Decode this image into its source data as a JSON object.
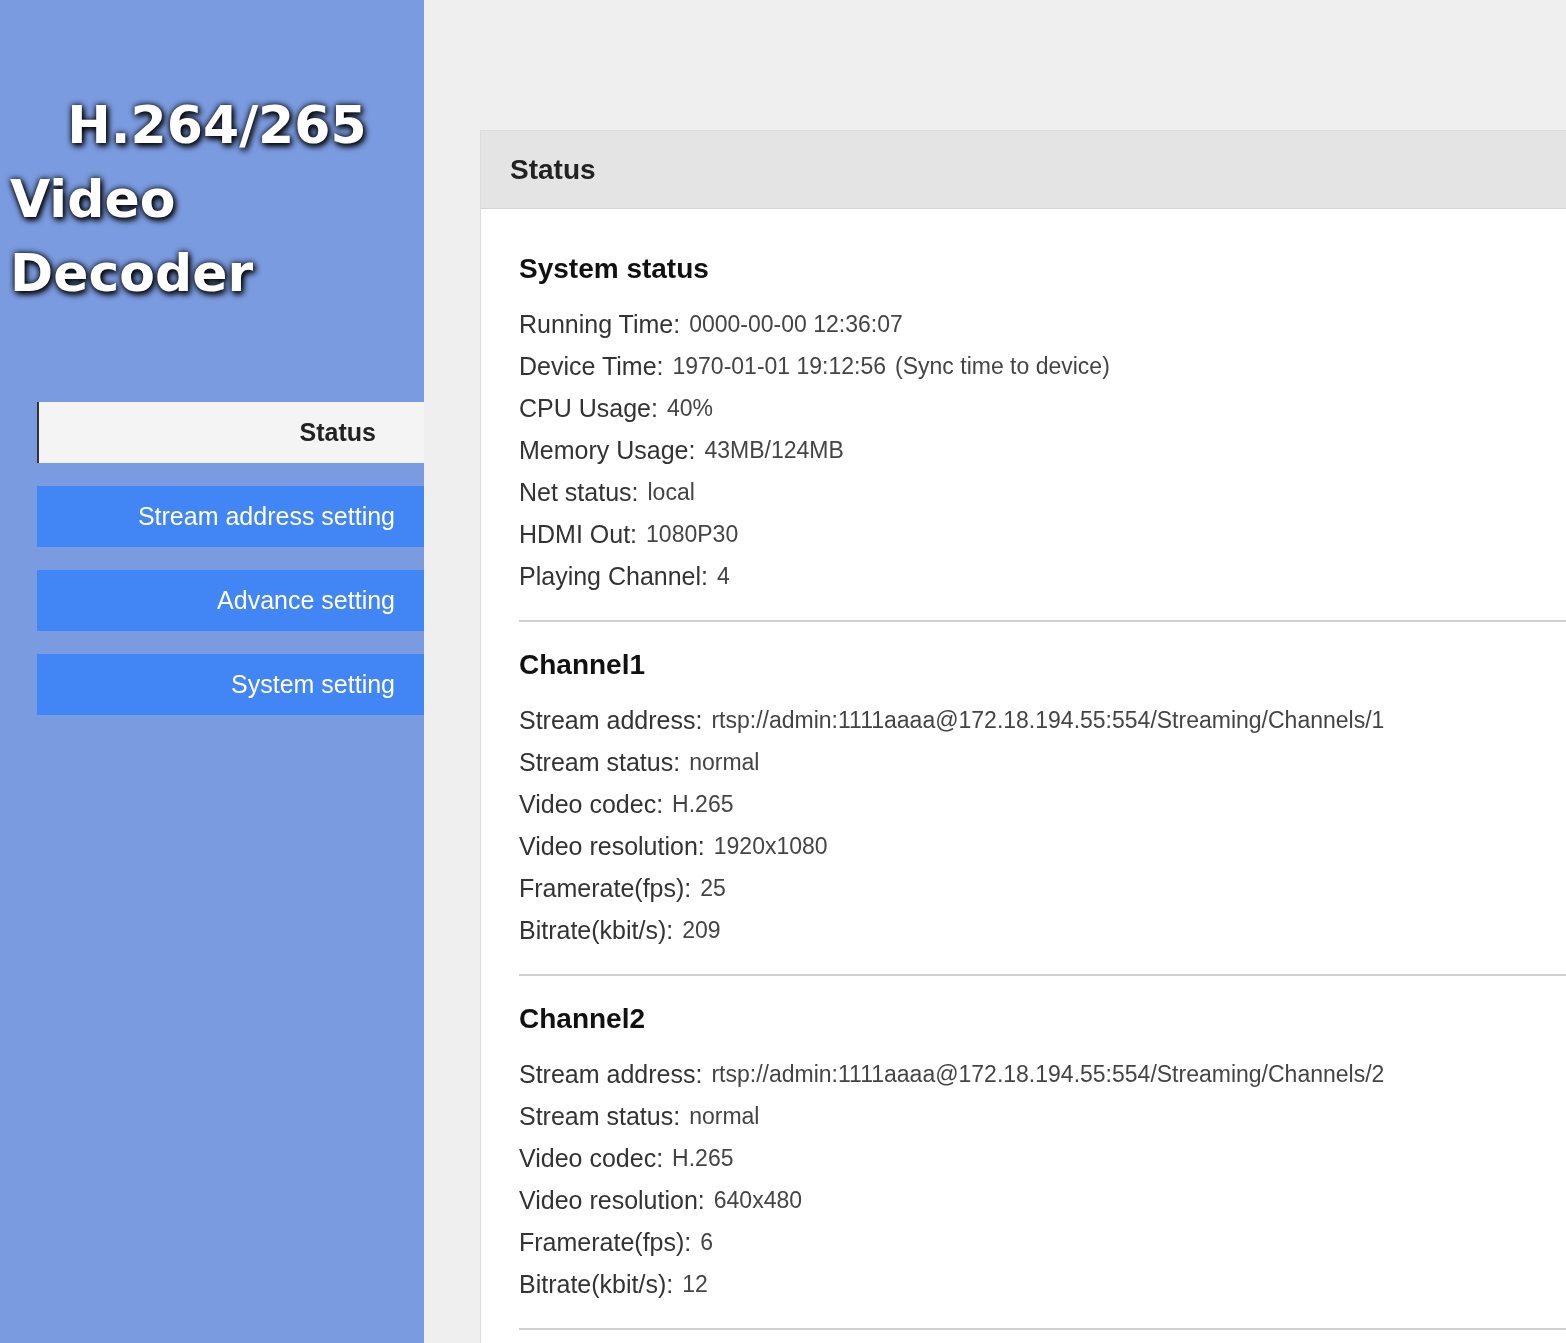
{
  "sidebar": {
    "logo": [
      "H.264/265",
      "Video Decoder"
    ],
    "items": [
      {
        "label": "Status",
        "selected": true
      },
      {
        "label": "Stream address setting",
        "selected": false
      },
      {
        "label": "Advance setting",
        "selected": false
      },
      {
        "label": "System setting",
        "selected": false
      }
    ]
  },
  "panel": {
    "title": "Status",
    "sections": [
      {
        "title": "System status",
        "rows": [
          {
            "label": "Running Time:",
            "value": "0000-00-00 12:36:07"
          },
          {
            "label": "Device Time:",
            "value": "1970-01-01 19:12:56",
            "link": "(Sync time to device)"
          },
          {
            "label": "CPU Usage:",
            "value": "40%"
          },
          {
            "label": "Memory Usage:",
            "value": "43MB/124MB"
          },
          {
            "label": "Net status:",
            "value": "local"
          },
          {
            "label": "HDMI Out:",
            "value": "1080P30"
          },
          {
            "label": "Playing Channel:",
            "value": "4"
          }
        ]
      },
      {
        "title": "Channel1",
        "rows": [
          {
            "label": "Stream address:",
            "value": "rtsp://admin:1111aaaa@172.18.194.55:554/Streaming/Channels/1"
          },
          {
            "label": "Stream status:",
            "value": "normal"
          },
          {
            "label": "Video codec:",
            "value": "H.265"
          },
          {
            "label": "Video resolution:",
            "value": "1920x1080"
          },
          {
            "label": "Framerate(fps):",
            "value": "25"
          },
          {
            "label": "Bitrate(kbit/s):",
            "value": "209"
          }
        ]
      },
      {
        "title": "Channel2",
        "rows": [
          {
            "label": "Stream address:",
            "value": "rtsp://admin:1111aaaa@172.18.194.55:554/Streaming/Channels/2"
          },
          {
            "label": "Stream status:",
            "value": "normal"
          },
          {
            "label": "Video codec:",
            "value": "H.265"
          },
          {
            "label": "Video resolution:",
            "value": "640x480"
          },
          {
            "label": "Framerate(fps):",
            "value": "6"
          },
          {
            "label": "Bitrate(kbit/s):",
            "value": "12"
          }
        ]
      }
    ]
  }
}
